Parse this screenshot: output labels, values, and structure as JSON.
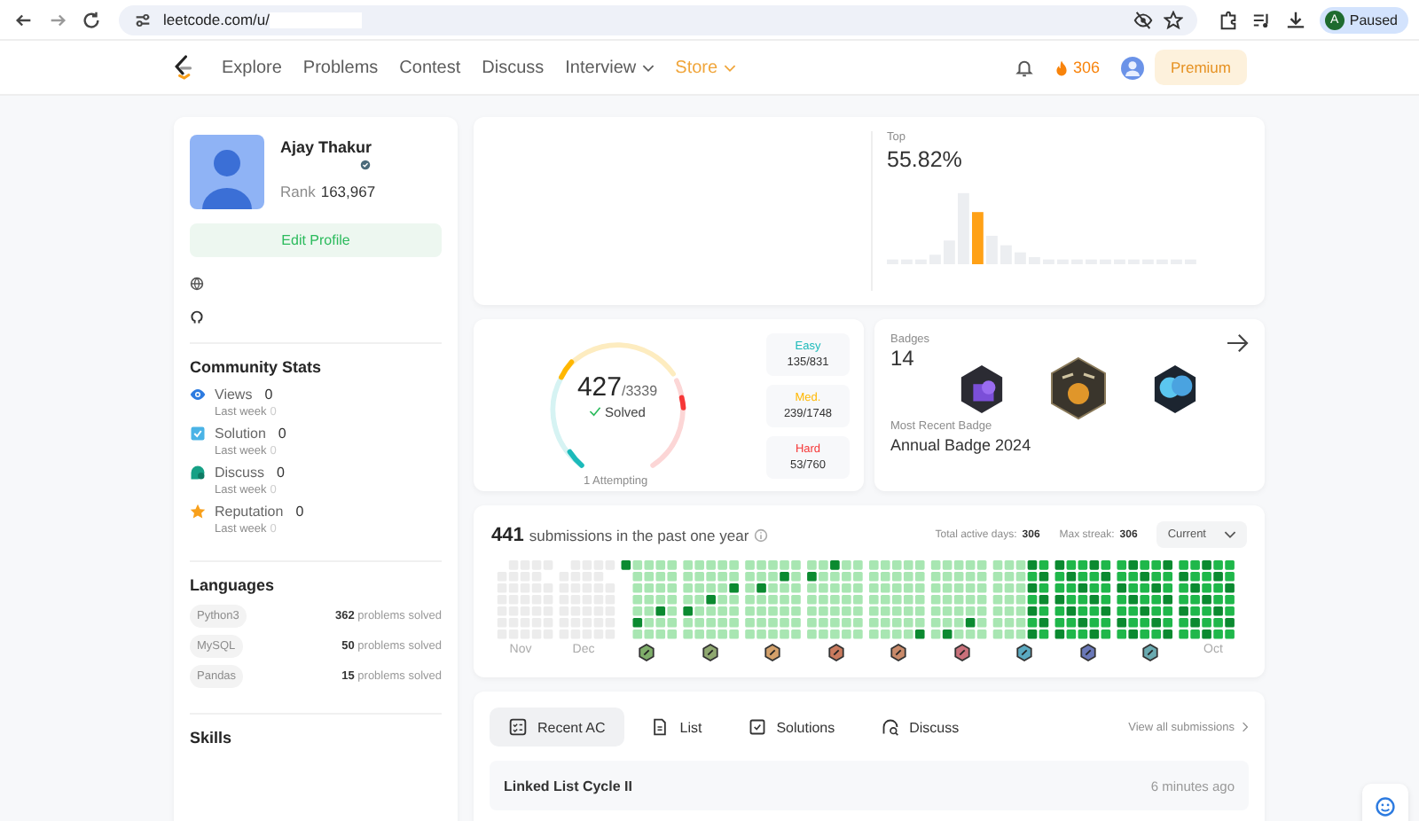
{
  "browser": {
    "url": "leetcode.com/u/",
    "profile_initial": "A",
    "profile_status": "Paused"
  },
  "nav": {
    "links": [
      {
        "label": "Explore",
        "dropdown": false,
        "highlight": false
      },
      {
        "label": "Problems",
        "dropdown": false,
        "highlight": false
      },
      {
        "label": "Contest",
        "dropdown": false,
        "highlight": false
      },
      {
        "label": "Discuss",
        "dropdown": false,
        "highlight": false
      },
      {
        "label": "Interview",
        "dropdown": true,
        "highlight": false
      },
      {
        "label": "Store",
        "dropdown": true,
        "highlight": true
      }
    ],
    "streak": "306",
    "premium": "Premium"
  },
  "profile": {
    "name": "Ajay Thakur",
    "rank_label": "Rank",
    "rank": "163,967",
    "edit_button": "Edit Profile"
  },
  "community_stats": {
    "title": "Community Stats",
    "items": [
      {
        "kind": "views",
        "label": "Views",
        "value": "0",
        "sub_label": "Last week",
        "sub_value": "0"
      },
      {
        "kind": "solution",
        "label": "Solution",
        "value": "0",
        "sub_label": "Last week",
        "sub_value": "0"
      },
      {
        "kind": "discuss",
        "label": "Discuss",
        "value": "0",
        "sub_label": "Last week",
        "sub_value": "0"
      },
      {
        "kind": "reputation",
        "label": "Reputation",
        "value": "0",
        "sub_label": "Last week",
        "sub_value": "0"
      }
    ]
  },
  "languages": {
    "title": "Languages",
    "items": [
      {
        "name": "Python3",
        "solved": "**362** problems solved"
      },
      {
        "name": "MySQL",
        "solved": "**50** problems solved"
      },
      {
        "name": "Pandas",
        "solved": "**15** problems solved"
      }
    ]
  },
  "skills": {
    "title": "Skills"
  },
  "contest_rank": {
    "top_label": "Top",
    "top_value": "55.82%"
  },
  "solved": {
    "count": "427",
    "total": "/3339",
    "status": "Solved",
    "attempting": "1 Attempting",
    "difficulties": [
      {
        "kind": "easy",
        "label": "Easy",
        "value": "135/831"
      },
      {
        "kind": "medium",
        "label": "Med.",
        "value": "239/1748"
      },
      {
        "kind": "hard",
        "label": "Hard",
        "value": "53/760"
      }
    ]
  },
  "badges": {
    "title": "Badges",
    "count": "14",
    "recent_label": "Most Recent Badge",
    "recent_name": "Annual Badge 2024"
  },
  "submissions": {
    "count": "441",
    "text": "submissions in the past one year",
    "active_days_label": "Total active days:",
    "active_days": "306",
    "max_streak_label": "Max streak:",
    "max_streak": "306",
    "period": "Current",
    "months": [
      {
        "kind": "label",
        "text": "Nov"
      },
      {
        "kind": "label",
        "text": "Dec"
      },
      {
        "kind": "badge",
        "color": "#7fae6a"
      },
      {
        "kind": "badge",
        "color": "#8fa870"
      },
      {
        "kind": "badge",
        "color": "#d3a06a"
      },
      {
        "kind": "badge",
        "color": "#c97a5e"
      },
      {
        "kind": "badge",
        "color": "#c98a6a"
      },
      {
        "kind": "badge",
        "color": "#c9707a"
      },
      {
        "kind": "badge",
        "color": "#5aa9c0"
      },
      {
        "kind": "badge",
        "color": "#6a78b8"
      },
      {
        "kind": "badge",
        "color": "#6aaab0"
      },
      {
        "kind": "label",
        "text": "Oct"
      }
    ]
  },
  "recent": {
    "tabs": [
      {
        "label": "Recent AC",
        "kind": "recent",
        "selected": true
      },
      {
        "label": "List",
        "kind": "list",
        "selected": false
      },
      {
        "label": "Solutions",
        "kind": "solutions",
        "selected": false
      },
      {
        "label": "Discuss",
        "kind": "discuss",
        "selected": false
      }
    ],
    "view_all": "View all submissions",
    "rows": [
      {
        "title": "Linked List Cycle II",
        "time": "6 minutes ago"
      }
    ]
  }
}
